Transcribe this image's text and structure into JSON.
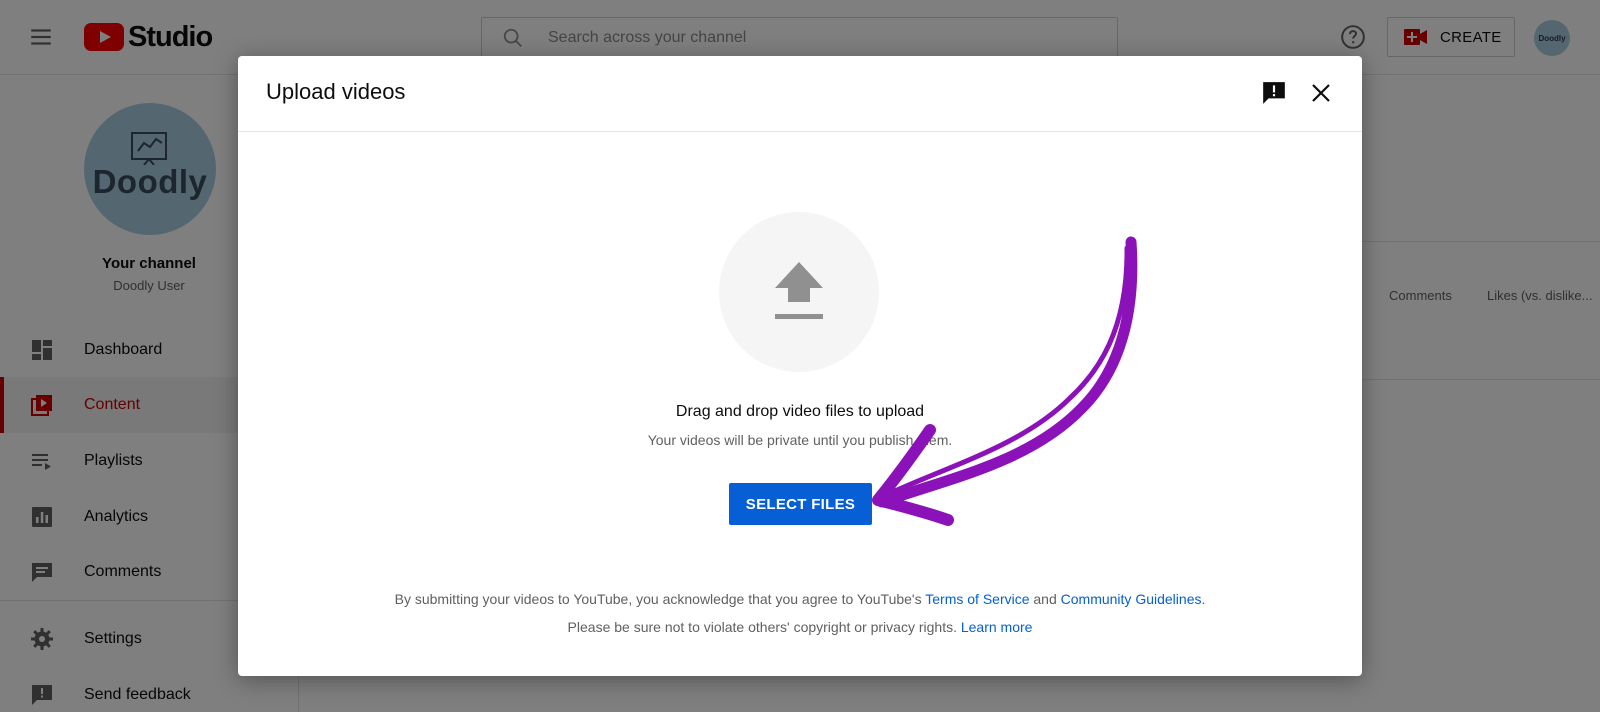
{
  "header": {
    "logo_text": "Studio",
    "search_placeholder": "Search across your channel",
    "create_label": "CREATE",
    "avatar_text": "Doodly"
  },
  "sidebar": {
    "channel_avatar_text": "Doodly",
    "channel_title": "Your channel",
    "channel_sub": "Doodly User",
    "items": [
      {
        "label": "Dashboard",
        "icon": "dashboard-icon",
        "active": false
      },
      {
        "label": "Content",
        "icon": "content-icon",
        "active": true
      },
      {
        "label": "Playlists",
        "icon": "playlists-icon",
        "active": false
      },
      {
        "label": "Analytics",
        "icon": "analytics-icon",
        "active": false
      },
      {
        "label": "Comments",
        "icon": "comments-icon",
        "active": false
      },
      {
        "label": "Settings",
        "icon": "gear-icon",
        "active": false
      },
      {
        "label": "Send feedback",
        "icon": "feedback-icon",
        "active": false
      }
    ]
  },
  "background": {
    "col_comments": "Comments",
    "col_likes": "Likes (vs. dislike..."
  },
  "dialog": {
    "title": "Upload videos",
    "drag_title": "Drag and drop video files to upload",
    "drag_sub": "Your videos will be private until you publish them.",
    "select_button": "SELECT FILES",
    "footer_text_1": "By submitting your videos to YouTube, you acknowledge that you agree to YouTube's ",
    "terms_link": "Terms of Service",
    "and_text": " and ",
    "guidelines_link": "Community Guidelines",
    "period": ".",
    "footer_text_2": "Please be sure not to violate others' copyright or privacy rights. ",
    "learn_more_link": "Learn more"
  },
  "colors": {
    "accent_blue": "#065fd4",
    "active_red": "#cc0000",
    "annotation_purple": "#8a12b8"
  }
}
